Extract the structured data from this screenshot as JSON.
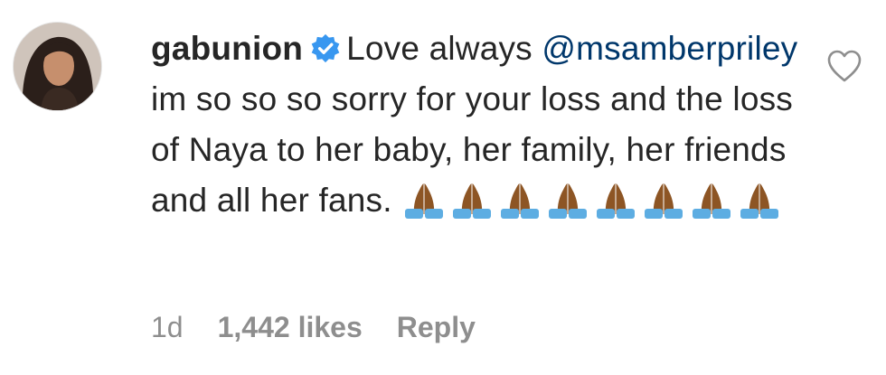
{
  "comment": {
    "username": "gabunion",
    "verified": true,
    "text_before_mention": "Love always",
    "mention": "@msamberpriley",
    "text_after_mention": "im so so so sorry for your loss and the loss of Naya to her baby, her family, her friends and all her fans.",
    "emojis": [
      "folded-hands-emoji",
      "folded-hands-emoji",
      "folded-hands-emoji",
      "folded-hands-emoji",
      "folded-hands-emoji",
      "folded-hands-emoji",
      "folded-hands-emoji",
      "folded-hands-emoji"
    ],
    "time": "1d",
    "likes": "1,442 likes",
    "reply_label": "Reply"
  },
  "icons": {
    "verified": "verified-badge-icon",
    "like": "heart-outline-icon"
  },
  "colors": {
    "text": "#262626",
    "mention": "#00376b",
    "meta": "#8e8e8e",
    "verified_badge": "#3897f0",
    "emoji_skin": "#8d5524",
    "emoji_sleeve": "#5dade2"
  }
}
